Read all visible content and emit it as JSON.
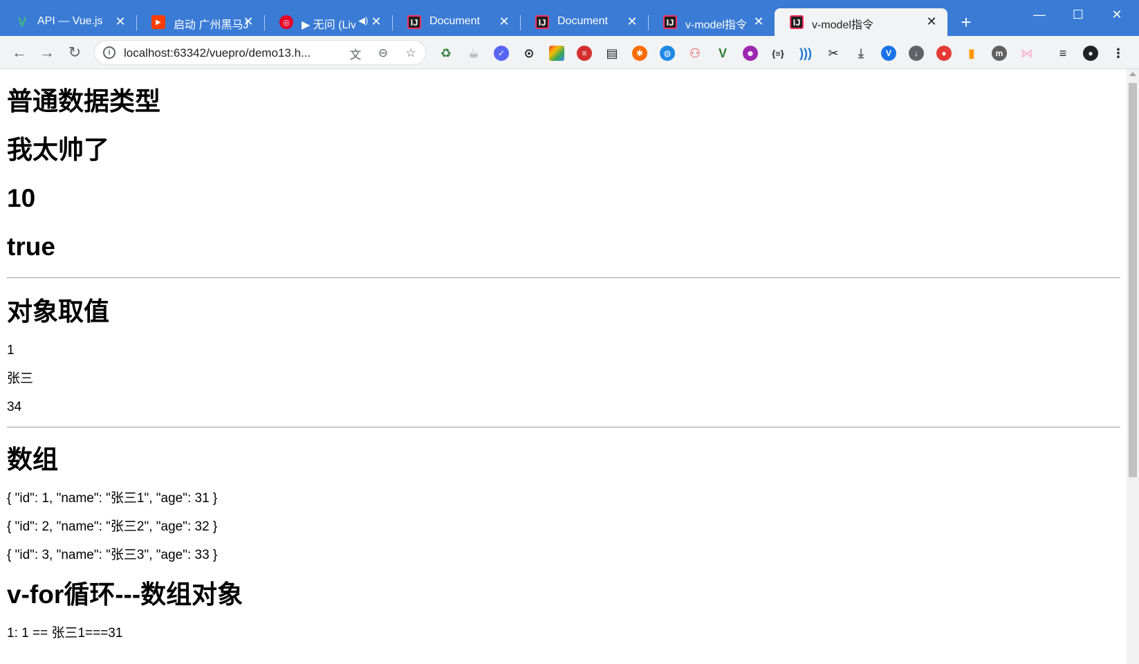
{
  "browser": {
    "tabs": [
      {
        "title": "API — Vue.js",
        "icon": "vue-icon",
        "active": false
      },
      {
        "title": "启动 广州黑马Ja",
        "icon": "youtube-icon",
        "active": false
      },
      {
        "title": "▶ 无问 (Live",
        "icon": "netease-music-icon",
        "active": false
      },
      {
        "title": "Document",
        "icon": "intellij-icon",
        "active": false
      },
      {
        "title": "Document",
        "icon": "intellij-icon",
        "active": false
      },
      {
        "title": "v-model指令",
        "icon": "intellij-icon",
        "active": false
      },
      {
        "title": "v-model指令",
        "icon": "intellij-icon",
        "active": true
      }
    ],
    "new_tab_label": "+",
    "url": "localhost:63342/vuepro/demo13.h...",
    "colors": {
      "tabstrip": "#3a7bd5",
      "toolbar": "#f1f3f4"
    }
  },
  "page": {
    "sections": {
      "basic_title": "普通数据类型",
      "basic_values": [
        "我太帅了",
        "10",
        "true"
      ],
      "object_title": "对象取值",
      "object_values": [
        "1",
        "张三",
        "34"
      ],
      "array_title": "数组",
      "array_values": [
        "{ \"id\": 1, \"name\": \"张三1\", \"age\": 31 }",
        "{ \"id\": 2, \"name\": \"张三2\", \"age\": 32 }",
        "{ \"id\": 3, \"name\": \"张三3\", \"age\": 33 }"
      ],
      "vfor_title": "v-for循环---数组对象",
      "vfor_values": [
        "1:  1 == 张三1===31"
      ]
    }
  }
}
